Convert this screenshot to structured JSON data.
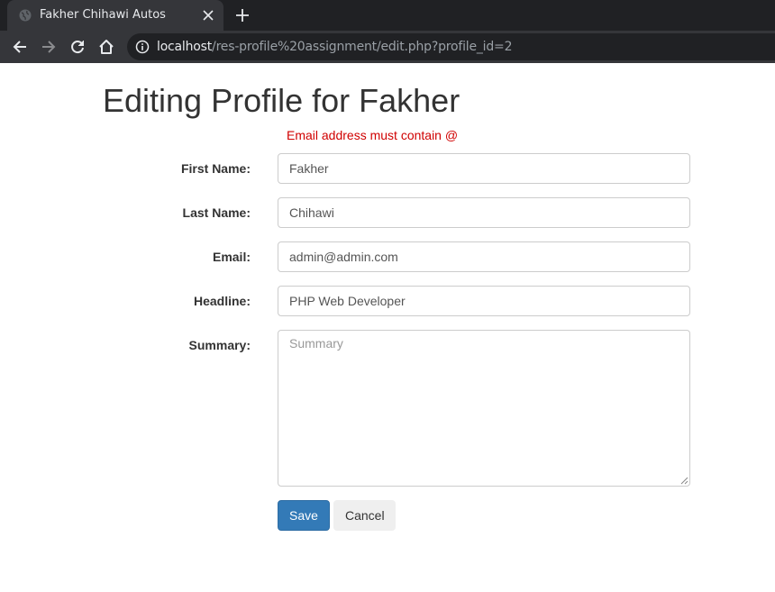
{
  "browser": {
    "tab_title": "Fakher Chihawi Autos",
    "url_host": "localhost",
    "url_path": "/res-profile%20assignment/edit.php?profile_id=2"
  },
  "page": {
    "title": "Editing Profile for Fakher",
    "error": "Email address must contain @"
  },
  "form": {
    "first_name": {
      "label": "First Name:",
      "value": "Fakher"
    },
    "last_name": {
      "label": "Last Name:",
      "value": "Chihawi"
    },
    "email": {
      "label": "Email:",
      "value": "admin@admin.com"
    },
    "headline": {
      "label": "Headline:",
      "value": "PHP Web Developer"
    },
    "summary": {
      "label": "Summary:",
      "value": "",
      "placeholder": "Summary"
    },
    "save_label": "Save",
    "cancel_label": "Cancel"
  },
  "colors": {
    "primary": "#337ab7",
    "error": "#d00000"
  }
}
